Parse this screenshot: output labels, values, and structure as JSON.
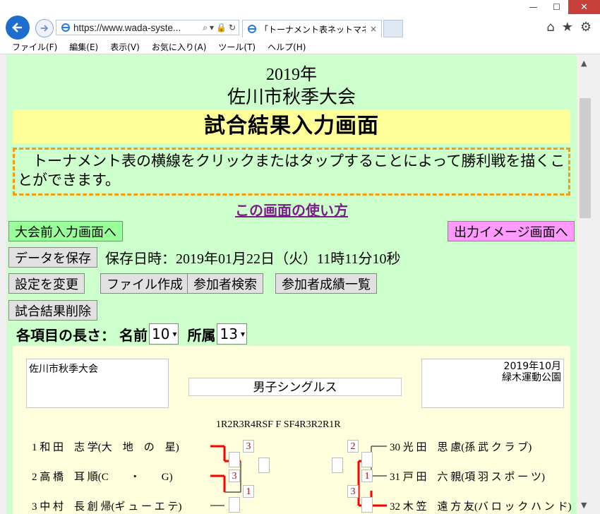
{
  "browser": {
    "url": "https://www.wada-syste...",
    "tab_title": "「トーナメント表ネットマネージャ...",
    "tab_close": "×",
    "window_buttons": [
      "—",
      "☐",
      "✕"
    ],
    "menu": [
      "ファイル(F)",
      "編集(E)",
      "表示(V)",
      "お気に入り(A)",
      "ツール(T)",
      "ヘルプ(H)"
    ]
  },
  "page": {
    "year": "2019年",
    "event_title": "佐川市秋季大会",
    "banner": "試合結果入力画面",
    "info": "トーナメント表の横線をクリックまたはタップすることによって勝利戦を描くことができます。",
    "howto_link": "この画面の使い方",
    "btn_pre": "大会前入力画面へ",
    "btn_output": "出力イメージ画面へ",
    "btn_save": "データを保存",
    "save_time": "保存日時：2019年01月22日（火）11時11分10秒",
    "btn_settings": "設定を変更",
    "btn_file": "ファイル作成",
    "btn_search": "参加者検索",
    "btn_results": "参加者成績一覧",
    "btn_delete": "試合結果削除",
    "len_label": "各項目の長さ：",
    "name_label": "名前",
    "name_value": "10",
    "affil_label": "所属",
    "affil_value": "13"
  },
  "bracket": {
    "left_box": "佐川市秋季大会",
    "center_box": "男子シングルス",
    "right_box_line1": "2019年10月",
    "right_box_line2": "緑木運動公園",
    "rounds_header": "1R2R3R4RSF  F  SF4R3R2R1R",
    "left_players": [
      "1 和 田　志 学(大　地　の　星)",
      "2 高 橋　耳 順(C　　・　　G)",
      "3 中 村　長 創 帰(ギ ュ ー エ テ)"
    ],
    "right_players": [
      "30 光 田　思 慮(孫 武 ク ラ ブ)",
      "31 戸 田　六 親(項 羽 ス ポ ー ツ)",
      "32 木 笠　遠 方 友(バ ロ ッ ク ハ ン ド)"
    ],
    "scores": {
      "s1": "3",
      "s2": "3",
      "s3": "1",
      "s4": "2",
      "s5": "1",
      "s6": "3"
    },
    "colors": {
      "win_line": "#ff0000",
      "line": "#555555",
      "score_text": "#cc0000"
    }
  }
}
